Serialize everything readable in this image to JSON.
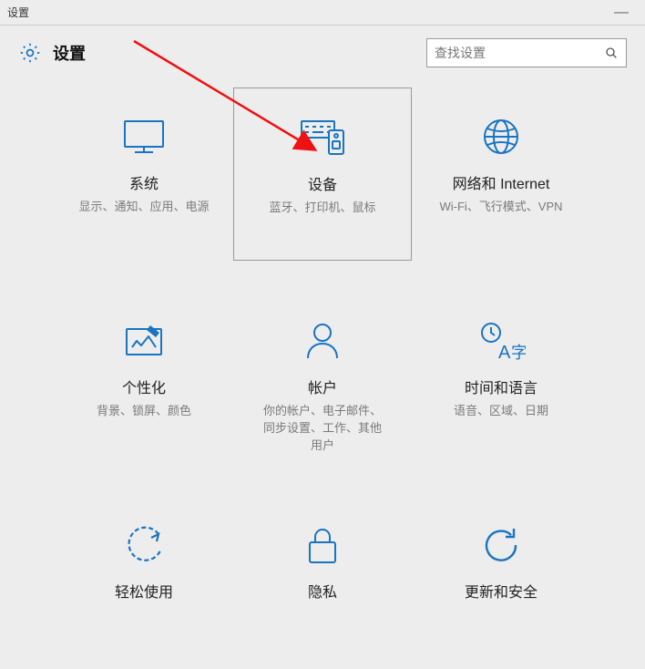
{
  "window": {
    "title": "设置",
    "minimize": "—"
  },
  "header": {
    "label": "设置"
  },
  "search": {
    "placeholder": "查找设置"
  },
  "tiles": [
    {
      "name": "系统",
      "desc": "显示、通知、应用、电源"
    },
    {
      "name": "设备",
      "desc": "蓝牙、打印机、鼠标"
    },
    {
      "name": "网络和 Internet",
      "desc": "Wi-Fi、飞行模式、VPN"
    },
    {
      "name": "个性化",
      "desc": "背景、锁屏、颜色"
    },
    {
      "name": "帐户",
      "desc": "你的帐户、电子邮件、\n同步设置、工作、其他\n用户"
    },
    {
      "name": "时间和语言",
      "desc": "语音、区域、日期"
    },
    {
      "name": "轻松使用",
      "desc": ""
    },
    {
      "name": "隐私",
      "desc": ""
    },
    {
      "name": "更新和安全",
      "desc": ""
    }
  ]
}
